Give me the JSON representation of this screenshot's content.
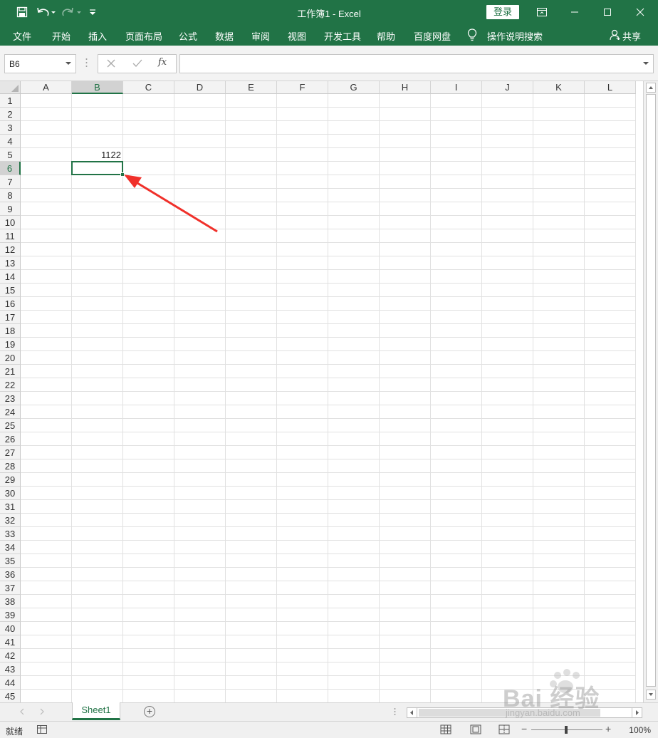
{
  "window": {
    "title": "工作簿1  -  Excel",
    "login_label": "登录",
    "accent_color": "#217346"
  },
  "quick_access": {
    "icons": [
      "save-icon",
      "undo-icon",
      "redo-icon",
      "customize-icon"
    ]
  },
  "ribbon": {
    "tabs": [
      {
        "label": "文件"
      },
      {
        "label": "开始"
      },
      {
        "label": "插入"
      },
      {
        "label": "页面布局"
      },
      {
        "label": "公式"
      },
      {
        "label": "数据"
      },
      {
        "label": "审阅"
      },
      {
        "label": "视图"
      },
      {
        "label": "开发工具"
      },
      {
        "label": "帮助"
      },
      {
        "label": "百度网盘"
      }
    ],
    "tell_me": "操作说明搜索",
    "share": "共享"
  },
  "formula_bar": {
    "name_box": "B6",
    "formula": "",
    "fx_label": "fx"
  },
  "sheet": {
    "columns": [
      "A",
      "B",
      "C",
      "D",
      "E",
      "F",
      "G",
      "H",
      "I",
      "J",
      "K",
      "L"
    ],
    "rows": [
      "1",
      "2",
      "3",
      "4",
      "5",
      "6",
      "7",
      "8",
      "9",
      "10",
      "11",
      "12",
      "13",
      "14",
      "15",
      "16",
      "17",
      "18",
      "19",
      "20",
      "21",
      "22",
      "23",
      "24",
      "25",
      "26",
      "27",
      "28",
      "29",
      "30",
      "31",
      "32",
      "33",
      "34",
      "35",
      "36",
      "37",
      "38",
      "39",
      "40",
      "41",
      "42",
      "43",
      "44",
      "45"
    ],
    "selected_column": "B",
    "selected_row": "6",
    "cells": [
      {
        "ref": "B5",
        "value": "1122"
      }
    ]
  },
  "sheet_tabs": {
    "tabs": [
      {
        "label": "Sheet1"
      }
    ],
    "add_label": "+"
  },
  "status_bar": {
    "status": "就绪",
    "zoom": "100%",
    "zoom_minus": "−",
    "zoom_plus": "+"
  },
  "watermark": {
    "brand": "Bai 经验",
    "url": "jingyan.baidu.com"
  }
}
